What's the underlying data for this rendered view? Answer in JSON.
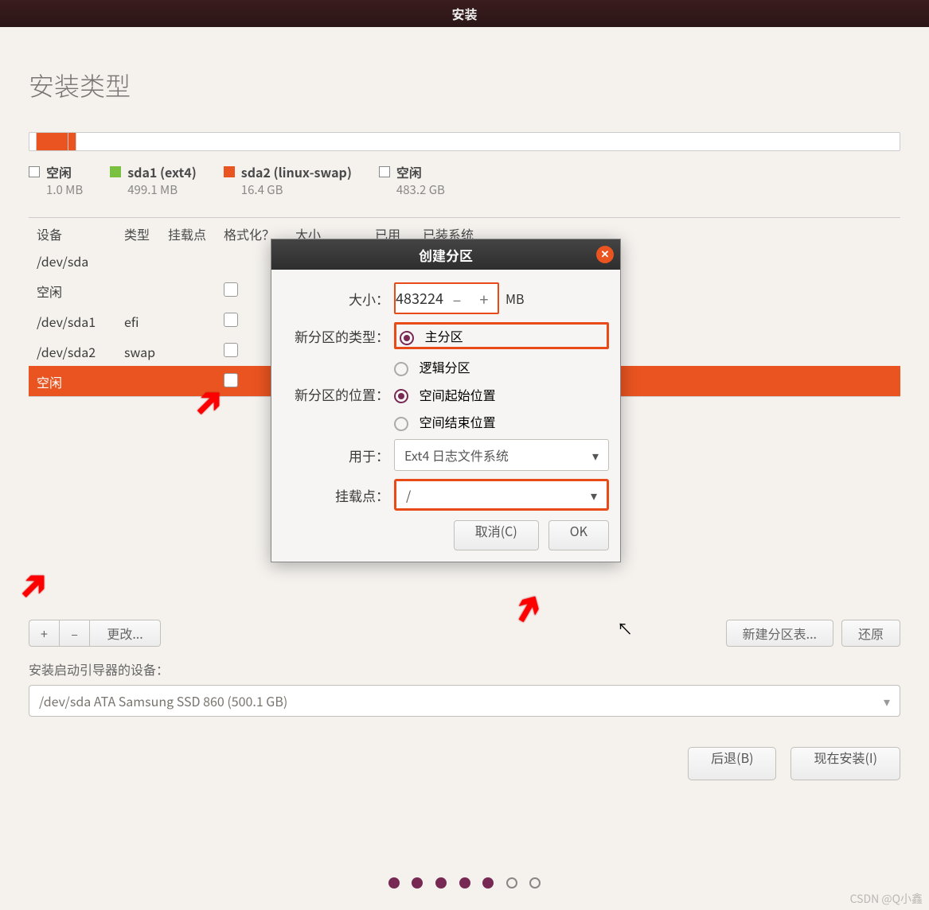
{
  "titlebar": "安装",
  "page_title": "安装类型",
  "legend": [
    {
      "label": "空闲",
      "size": "1.0 MB",
      "color": "#ffffff"
    },
    {
      "label": "sda1 (ext4)",
      "size": "499.1 MB",
      "color": "#7ac142"
    },
    {
      "label": "sda2 (linux-swap)",
      "size": "16.4 GB",
      "color": "#e95420"
    },
    {
      "label": "空闲",
      "size": "483.2 GB",
      "color": "#ffffff"
    }
  ],
  "table": {
    "headers": [
      "设备",
      "类型",
      "挂载点",
      "格式化？",
      "大小",
      "已用",
      "已装系统"
    ],
    "rows": [
      {
        "device": "/dev/sda",
        "type": "",
        "mount": "",
        "fmt": false,
        "size": "",
        "used": "",
        "sys": "",
        "has_chk": false
      },
      {
        "device": "空闲",
        "type": "",
        "mount": "",
        "fmt": false,
        "size": "",
        "used": "",
        "sys": "",
        "has_chk": true
      },
      {
        "device": "/dev/sda1",
        "type": "efi",
        "mount": "",
        "fmt": false,
        "size": "",
        "used": "",
        "sys": "",
        "has_chk": true
      },
      {
        "device": "/dev/sda2",
        "type": "swap",
        "mount": "",
        "fmt": false,
        "size": "",
        "used": "",
        "sys": "",
        "has_chk": true
      },
      {
        "device": "空闲",
        "type": "",
        "mount": "",
        "fmt": false,
        "size": "",
        "used": "",
        "sys": "",
        "has_chk": true,
        "selected": true
      }
    ]
  },
  "toolbar": {
    "plus": "+",
    "minus": "–",
    "change": "更改...",
    "newtable": "新建分区表...",
    "revert": "还原"
  },
  "boot": {
    "label": "安装启动引导器的设备：",
    "value": "/dev/sda   ATA Samsung SSD 860 (500.1 GB)"
  },
  "footer": {
    "back": "后退(B)",
    "install": "现在安装(I)"
  },
  "dialog": {
    "title": "创建分区",
    "sizeLabel": "大小：",
    "sizeValue": "483224",
    "sizeUnit": "MB",
    "typeLabel": "新分区的类型：",
    "type_primary": "主分区",
    "type_logical": "逻辑分区",
    "locLabel": "新分区的位置：",
    "loc_begin": "空间起始位置",
    "loc_end": "空间结束位置",
    "useLabel": "用于：",
    "useValue": "Ext4 日志文件系统",
    "mountLabel": "挂载点：",
    "mountValue": "/",
    "cancel": "取消(C)",
    "ok": "OK"
  },
  "watermark": "CSDN @Q小鑫"
}
